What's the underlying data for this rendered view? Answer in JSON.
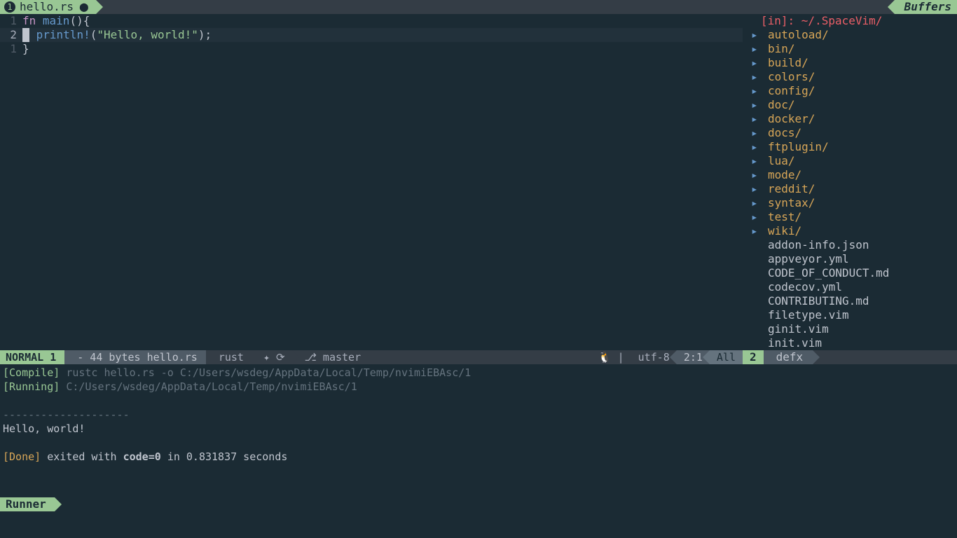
{
  "tabs": {
    "left": {
      "index": "1",
      "label": "hello.rs",
      "modified": "⬤"
    },
    "right": {
      "label": "Buffers"
    }
  },
  "editor": {
    "lines": [
      {
        "gutter": "1",
        "hl": false,
        "tokens": [
          {
            "cls": "kw",
            "t": "fn"
          },
          {
            "cls": "punc",
            "t": " "
          },
          {
            "cls": "fn",
            "t": "main"
          },
          {
            "cls": "punc",
            "t": "(){"
          }
        ]
      },
      {
        "gutter": "2",
        "hl": true,
        "cursor": true,
        "tokens": [
          {
            "cls": "punc",
            "t": "    "
          },
          {
            "cls": "mac",
            "t": "println!"
          },
          {
            "cls": "punc",
            "t": "("
          },
          {
            "cls": "str",
            "t": "\"Hello, world!\""
          },
          {
            "cls": "punc",
            "t": ");"
          }
        ]
      },
      {
        "gutter": "1",
        "hl": false,
        "tokens": [
          {
            "cls": "punc",
            "t": "}"
          }
        ]
      }
    ]
  },
  "filepanel": {
    "header": "[in]: ~/.SpaceVim/",
    "dirs": [
      "autoload/",
      "bin/",
      "build/",
      "colors/",
      "config/",
      "doc/",
      "docker/",
      "docs/",
      "ftplugin/",
      "lua/",
      "mode/",
      "reddit/",
      "syntax/",
      "test/",
      "wiki/"
    ],
    "files": [
      "addon-info.json",
      "appveyor.yml",
      "CODE_OF_CONDUCT.md",
      "codecov.yml",
      "CONTRIBUTING.md",
      "filetype.vim",
      "ginit.vim",
      "init.vim"
    ]
  },
  "status_left": {
    "mode": "NORMAL 1",
    "bytes": "- 44 bytes hello.rs",
    "ft": "rust",
    "sync": "✦ ⟳",
    "git": "⎇ master",
    "os": "🐧 |",
    "enc": "utf-8",
    "pos": "2:1",
    "pct": "All"
  },
  "status_right": {
    "index": "2",
    "name": "defx"
  },
  "runner": {
    "compile_label": "[Compile]",
    "compile_cmd": "rustc hello.rs -o C:/Users/wsdeg/AppData/Local/Temp/nvimiEBAsc/1",
    "running_label": "[Running]",
    "running_cmd": "C:/Users/wsdeg/AppData/Local/Temp/nvimiEBAsc/1",
    "sep": "--------------------",
    "output": "Hello, world!",
    "done_label": "[Done]",
    "done_rest": "exited with ",
    "done_code": "code=0",
    "done_tail": " in 0.831837 seconds"
  },
  "bottom_tab": "Runner"
}
